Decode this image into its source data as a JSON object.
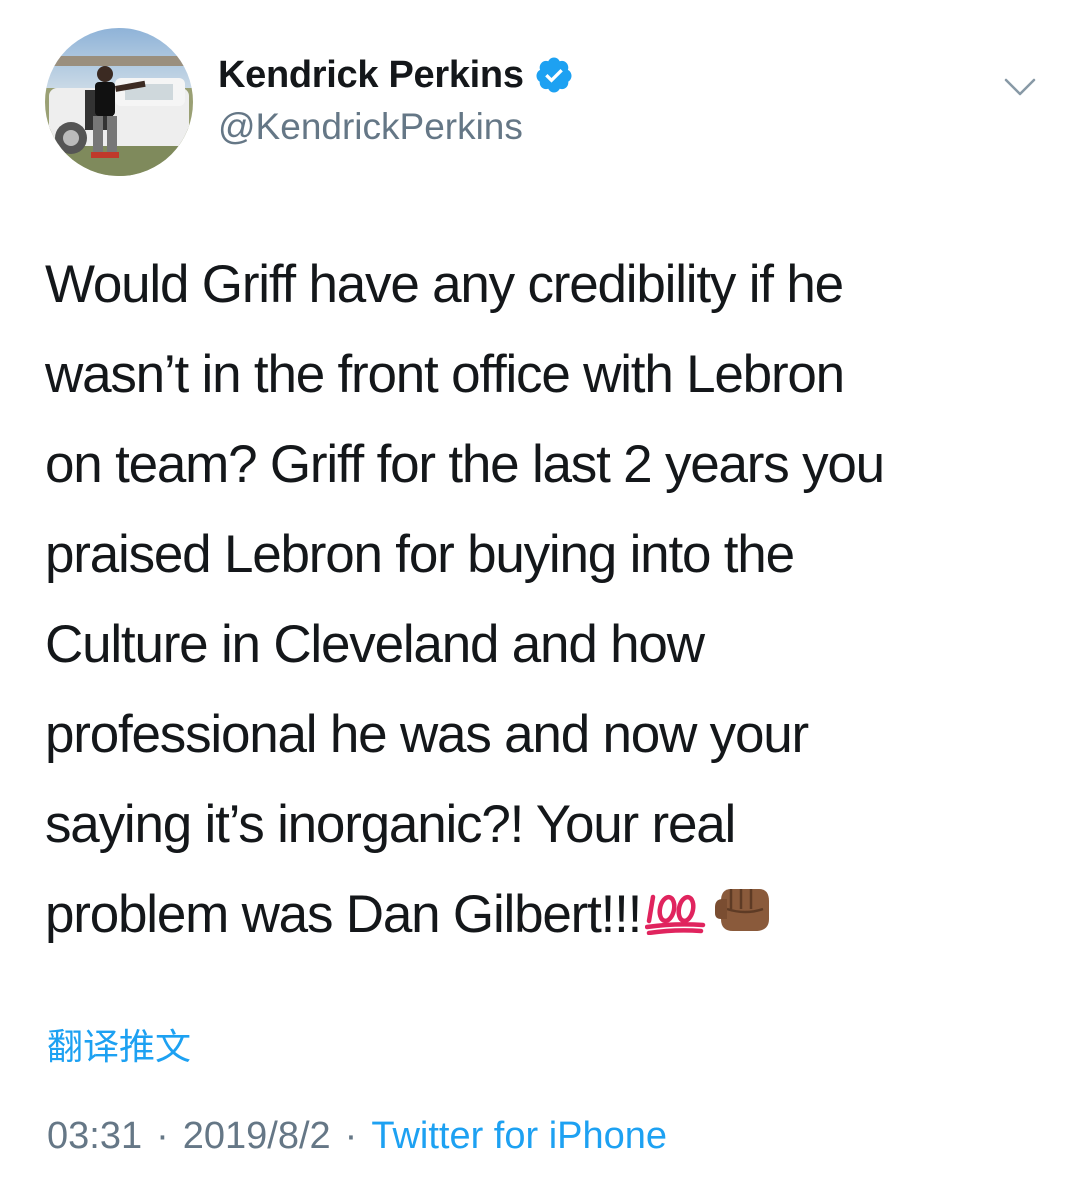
{
  "user": {
    "display_name": "Kendrick Perkins",
    "handle": "@KendrickPerkins",
    "verified": true,
    "avatar_icon": "profile-photo"
  },
  "tweet": {
    "lines": [
      "Would Griff have any credibility if he",
      "wasn’t in the front office with Lebron",
      "on team? Griff for the last 2 years you",
      "praised Lebron for buying into the",
      "Culture in Cleveland and how",
      "professional he was and now your",
      "saying it’s inorganic?! Your real",
      "problem was Dan Gilbert!!!"
    ],
    "emojis": [
      "hundred-points-icon",
      "fist-icon"
    ]
  },
  "translate_label": "翻译推文",
  "meta": {
    "time": "03:31",
    "date": "2019/8/2",
    "separator": "·",
    "source": "Twitter for iPhone"
  },
  "colors": {
    "link": "#1da1f2",
    "secondary_text": "#657786",
    "primary_text": "#14171a",
    "verified_badge": "#1da1f2"
  }
}
